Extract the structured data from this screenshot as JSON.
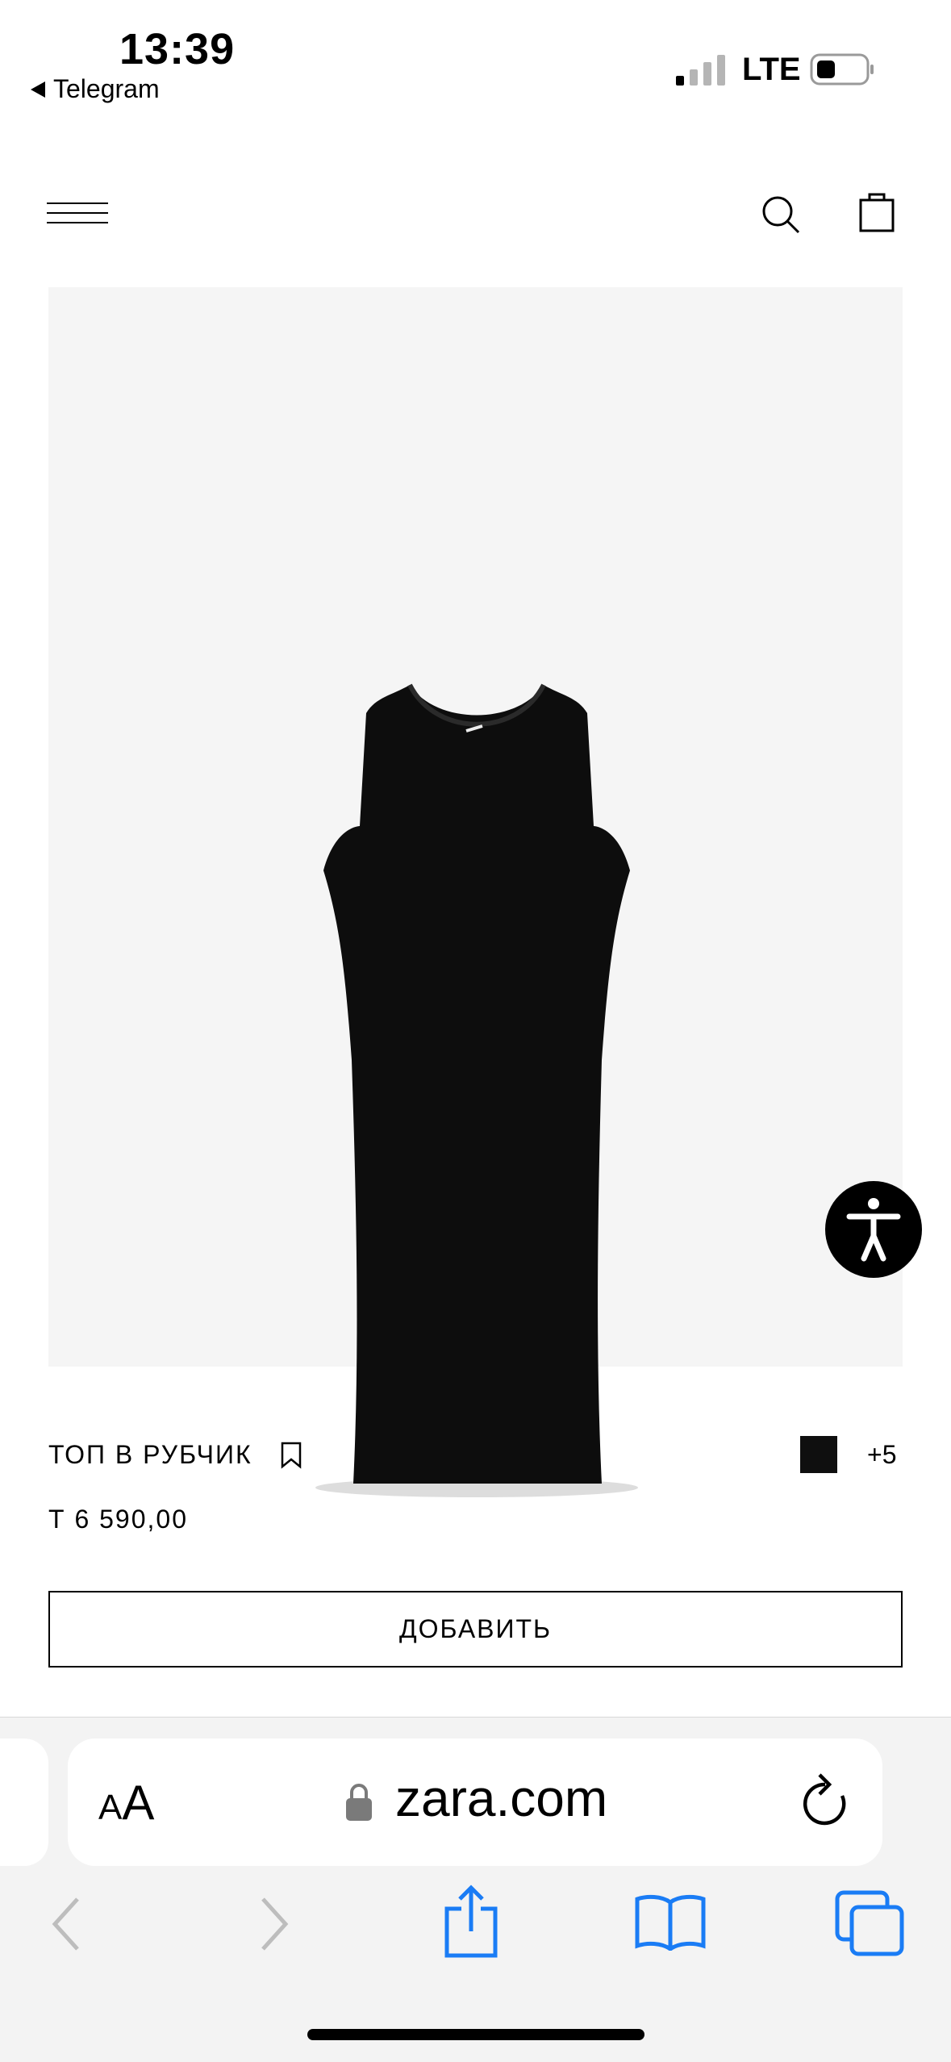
{
  "status_bar": {
    "time": "13:39",
    "back_app": "Telegram",
    "network": "LTE"
  },
  "header": {
    "menu_icon": "hamburger-icon",
    "search_icon": "search-icon",
    "bag_icon": "shopping-bag-icon"
  },
  "product": {
    "title": "ТОП В РУБЧИК",
    "price": "Т 6 590,00",
    "color_hex": "#0f0f0f",
    "more_colors": "+5",
    "add_button": "ДОБАВИТЬ",
    "image_background": "#f5f5f5"
  },
  "safari": {
    "text_size_label_small": "A",
    "text_size_label_large": "A",
    "url": "zara.com",
    "accent_color": "#1a7cf5"
  }
}
